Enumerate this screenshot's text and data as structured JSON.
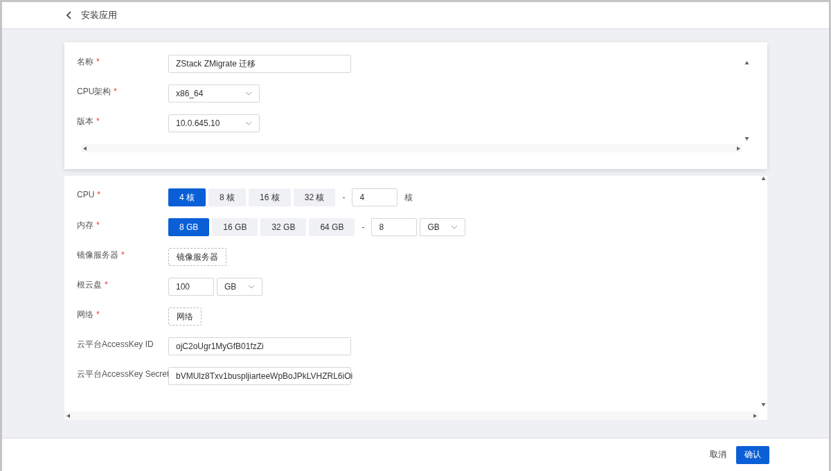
{
  "header": {
    "title": "安装应用"
  },
  "basic_form": {
    "fields": [
      {
        "kind": "text",
        "label": "名称",
        "required_mark": "*",
        "value": "ZStack ZMigrate 迁移"
      },
      {
        "kind": "select",
        "label": "CPU架构",
        "required_mark": "*",
        "value": "x86_64"
      },
      {
        "kind": "select",
        "label": "版本",
        "required_mark": "*",
        "value": "10.0.645.10"
      }
    ]
  },
  "resource_form": {
    "fields": [
      {
        "kind": "choice",
        "label": "CPU",
        "required_mark": "*",
        "options": [
          {
            "label": "4 核",
            "selected": true
          },
          {
            "label": "8 核",
            "selected": false
          },
          {
            "label": "16 核",
            "selected": false
          },
          {
            "label": "32 核",
            "selected": false
          }
        ],
        "separator": "-",
        "value": "4",
        "unit": "核"
      },
      {
        "kind": "choice",
        "label": "内存",
        "required_mark": "*",
        "options": [
          {
            "label": "8 GB",
            "selected": true
          },
          {
            "label": "16 GB",
            "selected": false
          },
          {
            "label": "32 GB",
            "selected": false
          },
          {
            "label": "64 GB",
            "selected": false
          }
        ],
        "separator": "-",
        "value": "8",
        "unit_select": "GB"
      },
      {
        "kind": "picker",
        "label": "镜像服务器",
        "required_mark": "*",
        "button": "镜像服务器"
      },
      {
        "kind": "size",
        "label": "根云盘",
        "required_mark": "*",
        "value": "100",
        "unit_select": "GB"
      },
      {
        "kind": "picker",
        "label": "网络",
        "required_mark": "*",
        "button": "网络"
      },
      {
        "kind": "text",
        "label": "云平台AccessKey ID",
        "value": "ojC2oUgr1MyGfB01fzZi"
      },
      {
        "kind": "text",
        "label": "云平台AccessKey Secret",
        "value": "bVMUlz8Txv1buspljiarteeWpBoJPkLVHZRL6iOi"
      }
    ]
  },
  "footer": {
    "buttons": [
      {
        "label": "取消",
        "kind": "text"
      },
      {
        "label": "确认",
        "kind": "primary"
      }
    ]
  }
}
